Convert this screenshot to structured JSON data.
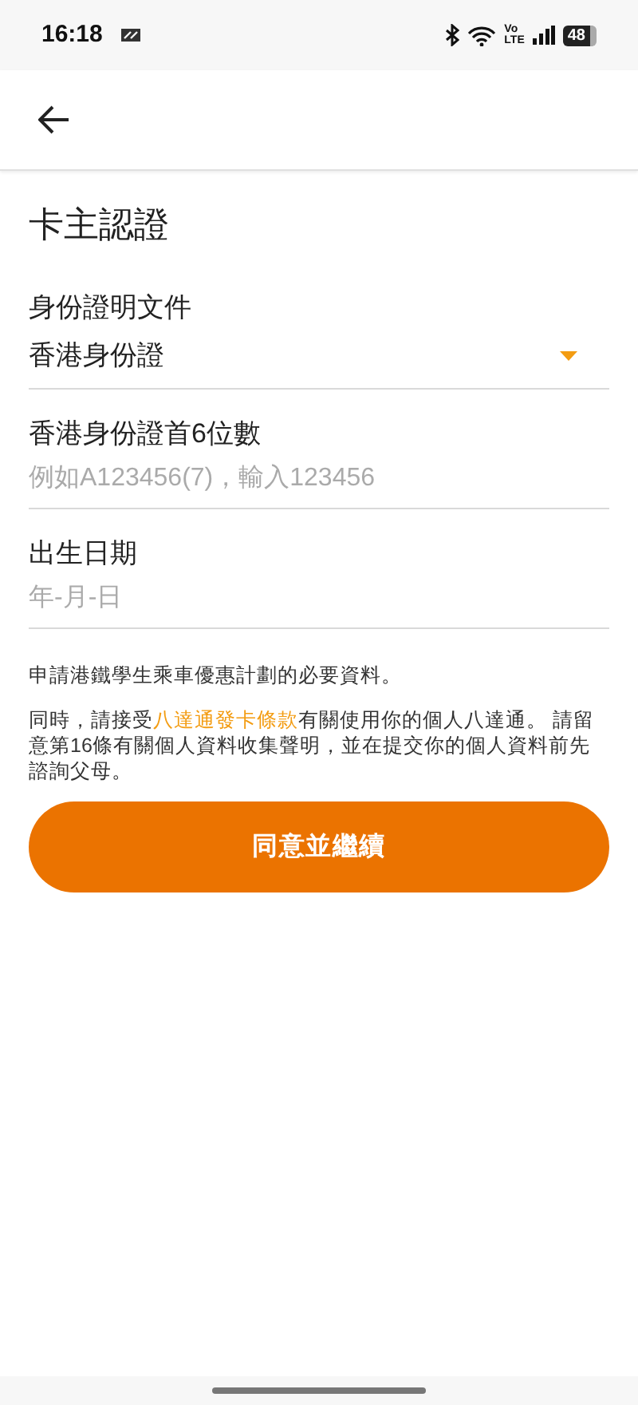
{
  "status_bar": {
    "time": "16:18",
    "volte_top": "Vo",
    "volte_bottom": "LTE",
    "battery": "48"
  },
  "title": "卡主認證",
  "fields": [
    {
      "kind": "select",
      "label": "身份證明文件",
      "value": "香港身份證"
    },
    {
      "kind": "text",
      "label": "香港身份證首6位數",
      "placeholder": "例如A123456(7)，輸入123456"
    },
    {
      "kind": "text",
      "label": "出生日期",
      "placeholder": "年-月-日"
    }
  ],
  "note": "申請港鐵學生乘車優惠計劃的必要資料。",
  "consent": {
    "before": "同時，請接受",
    "link": "八達通發卡條款",
    "after": "有關使用你的個人八達通。 請留意第16條有關個人資料收集聲明，並在提交你的個人資料前先諮詢父母。"
  },
  "button": "同意並繼續"
}
